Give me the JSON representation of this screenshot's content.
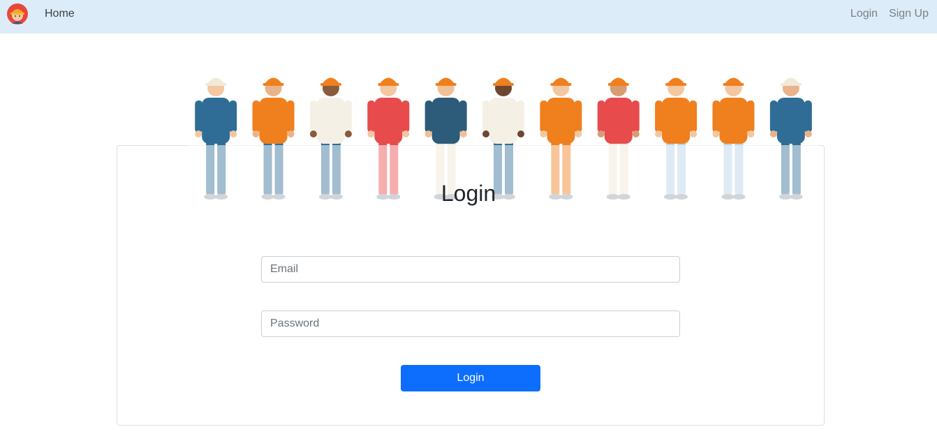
{
  "nav": {
    "logo_icon": "worker-avatar-icon",
    "home_label": "Home",
    "login_label": "Login",
    "signup_label": "Sign Up"
  },
  "banner": {
    "icon": "construction-workers-illustration",
    "worker_count": 11
  },
  "form": {
    "title": "Login",
    "email_placeholder": "Email",
    "password_placeholder": "Password",
    "submit_label": "Login"
  },
  "colors": {
    "navbar_bg": "#dcecf9",
    "primary": "#0d6efd",
    "hardhat": "#f07f1e"
  }
}
